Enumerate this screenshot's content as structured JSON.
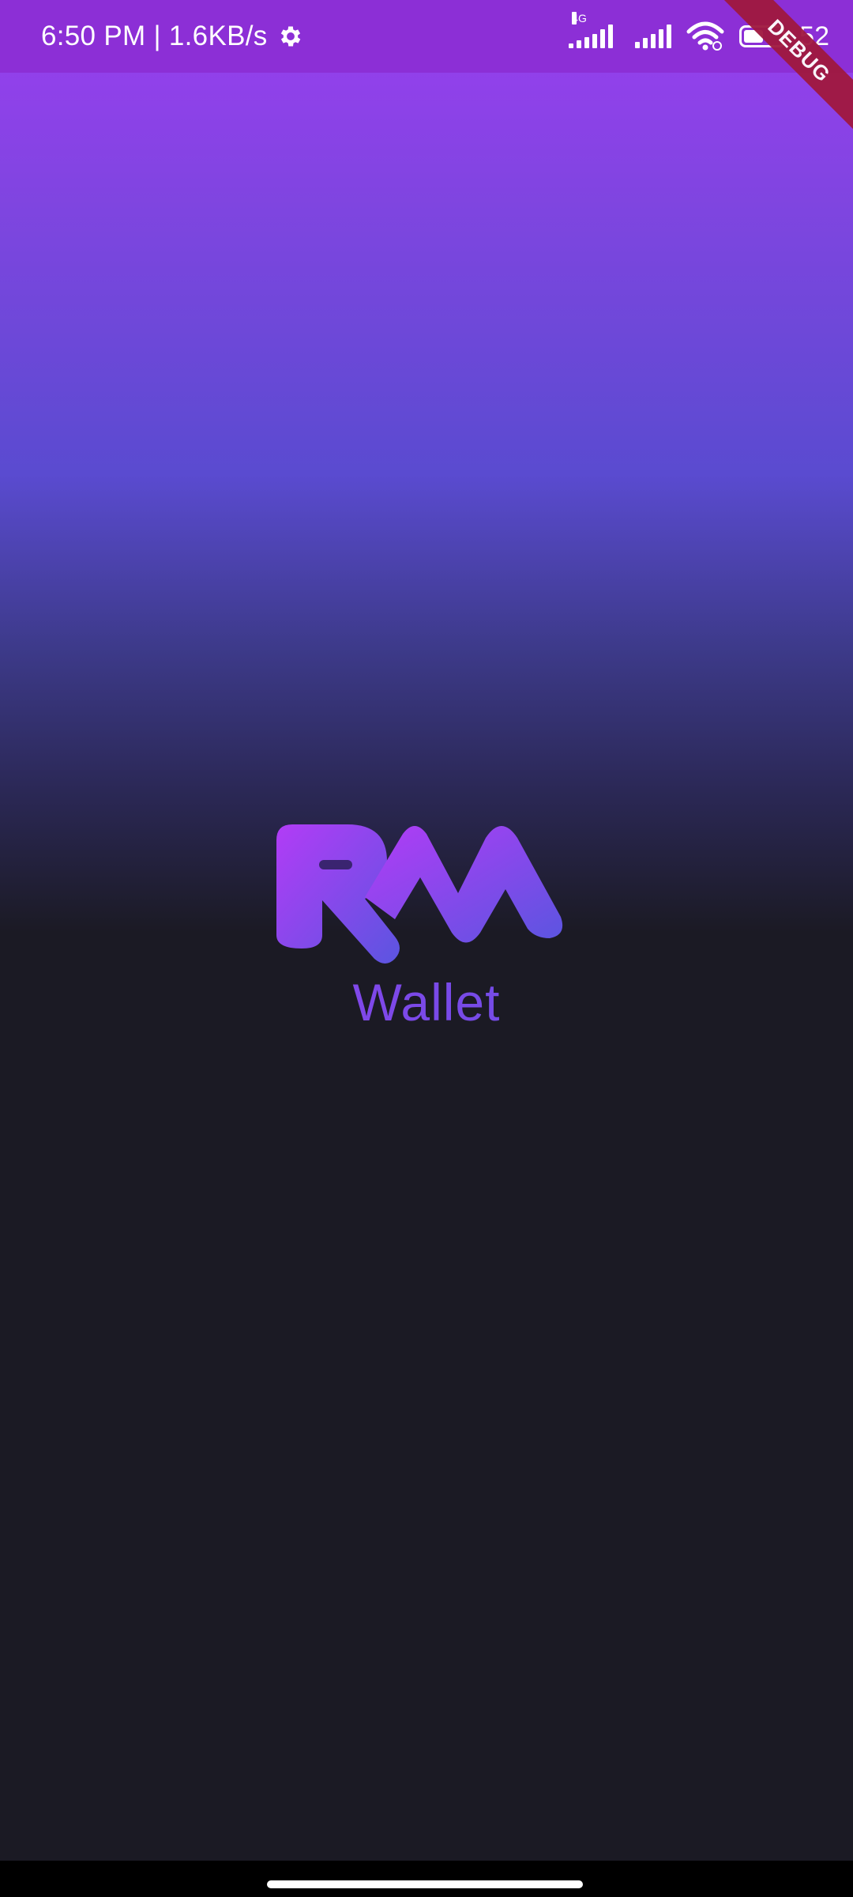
{
  "status_bar": {
    "time_speed": "6:50 PM | 1.6KB/s",
    "network_type": "4G",
    "battery_level": "52",
    "icons": [
      "gear-icon",
      "cellular-signal-icon",
      "wifi-icon",
      "battery-icon"
    ]
  },
  "debug_banner": {
    "label": "DEBUG"
  },
  "brand": {
    "logo_text": "RM",
    "wallet_label": "Wallet"
  },
  "colors": {
    "status_bar": "#8c2fd6",
    "gradient_top": "#9b3ef0",
    "gradient_mid": "#5a4bd0",
    "background": "#1b1a24",
    "logo_start": "#b23cf6",
    "logo_end": "#5b55e0",
    "debug_ribbon": "#a0183f"
  }
}
